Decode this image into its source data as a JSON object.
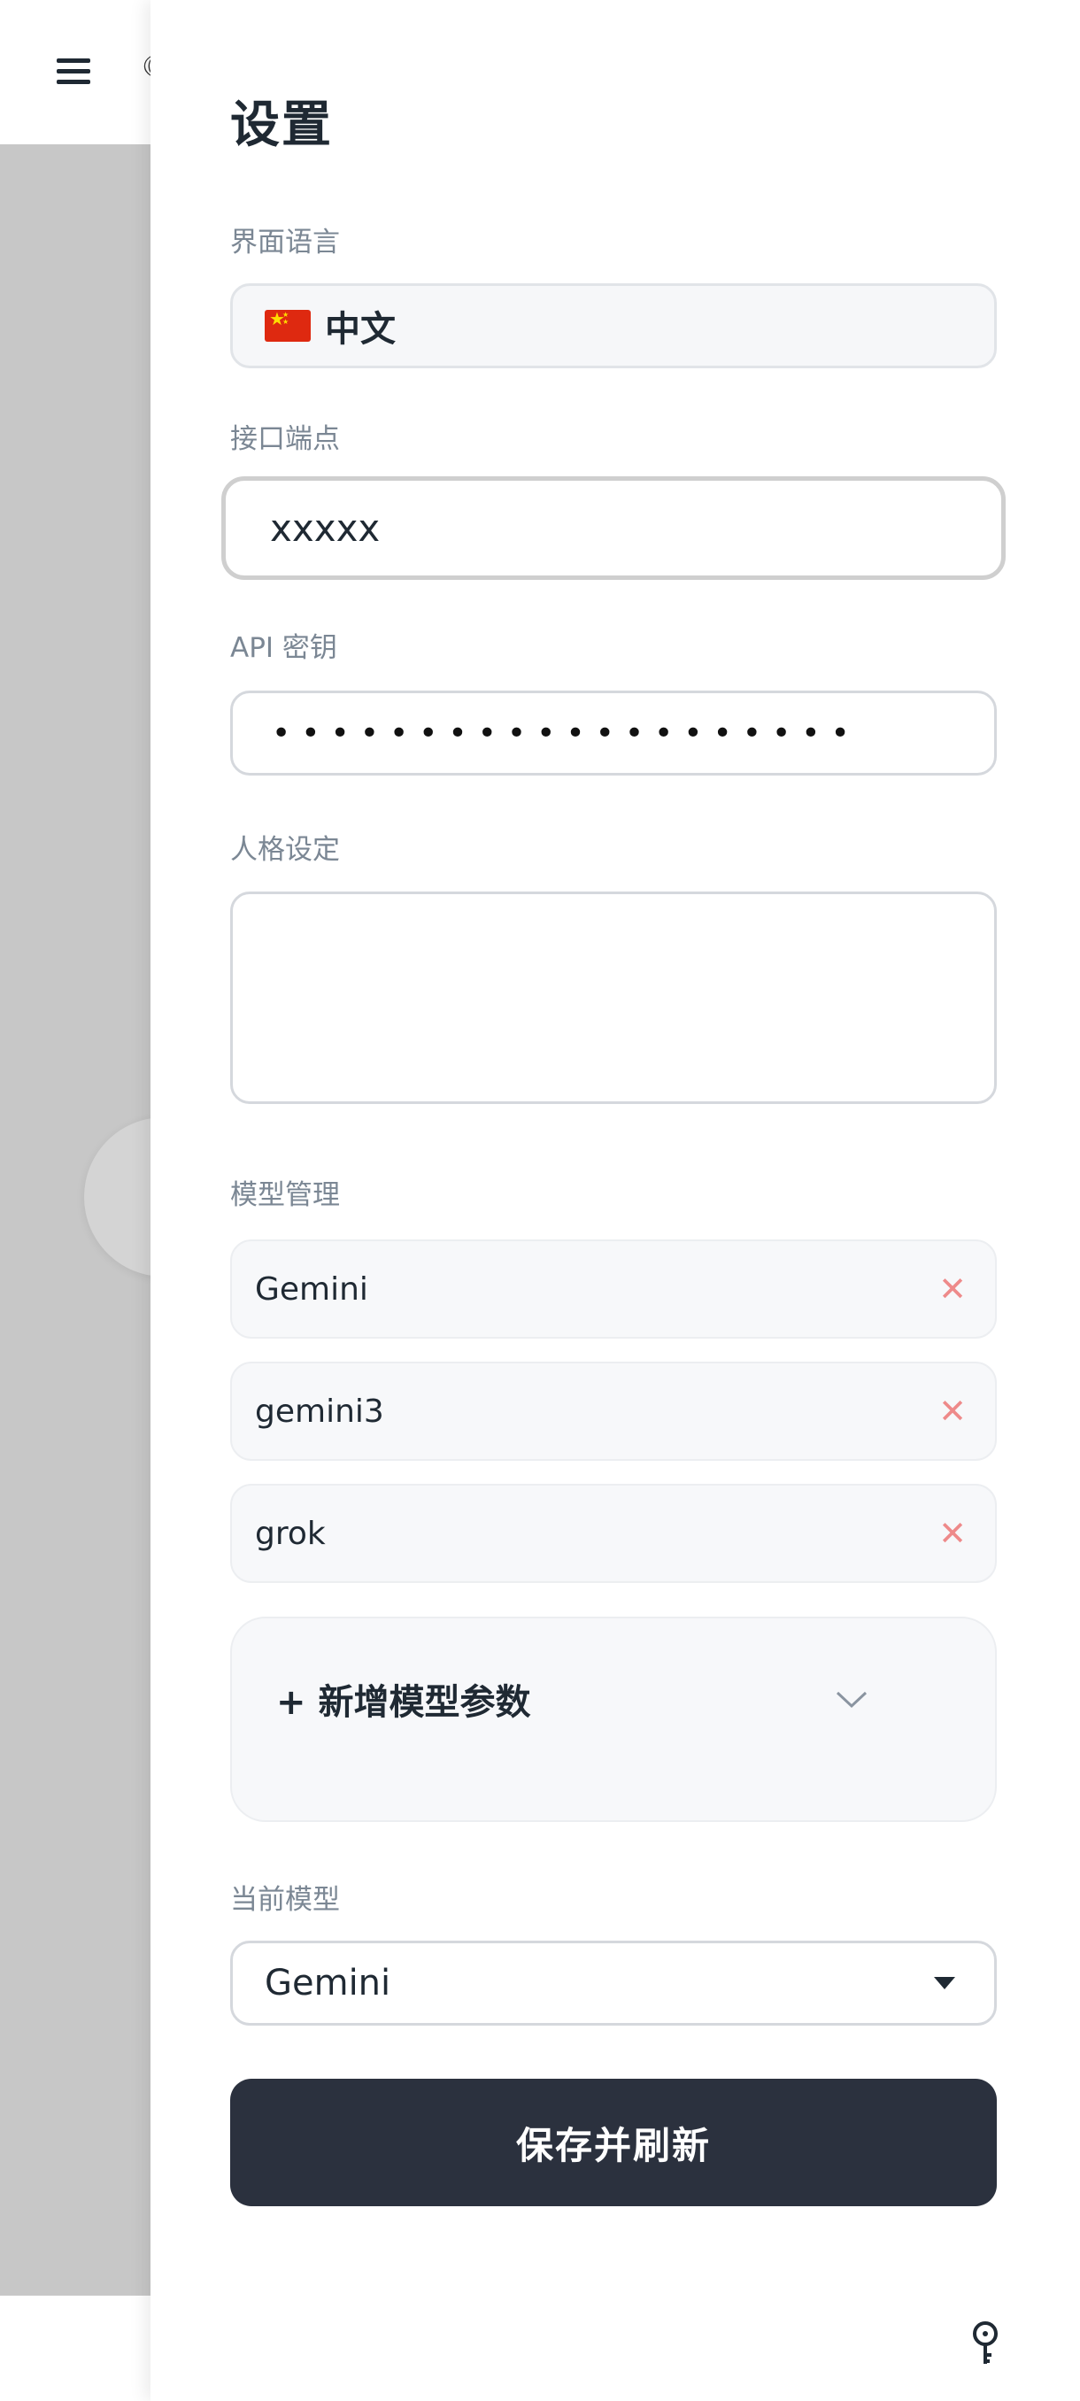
{
  "app": {
    "logo_glyph": "☾"
  },
  "settings": {
    "title": "设置",
    "language": {
      "label": "界面语言",
      "value": "中文",
      "flag": "cn-flag"
    },
    "endpoint": {
      "label": "接口端点",
      "value": "xxxxx"
    },
    "api_key": {
      "label": "API 密钥",
      "masked_value": "••••••••••••••••••••"
    },
    "persona": {
      "label": "人格设定",
      "value": ""
    },
    "models": {
      "label": "模型管理",
      "items": [
        {
          "name": "Gemini",
          "remove": "✕"
        },
        {
          "name": "gemini3",
          "remove": "✕"
        },
        {
          "name": "grok",
          "remove": "✕"
        }
      ],
      "add_label": "+ 新增模型参数"
    },
    "current_model": {
      "label": "当前模型",
      "value": "Gemini"
    },
    "save_label": "保存并刷新"
  },
  "colors": {
    "primary_button": "#2b313e",
    "remove_icon": "#ee8a8a",
    "overlay": "#c7c7c7"
  }
}
